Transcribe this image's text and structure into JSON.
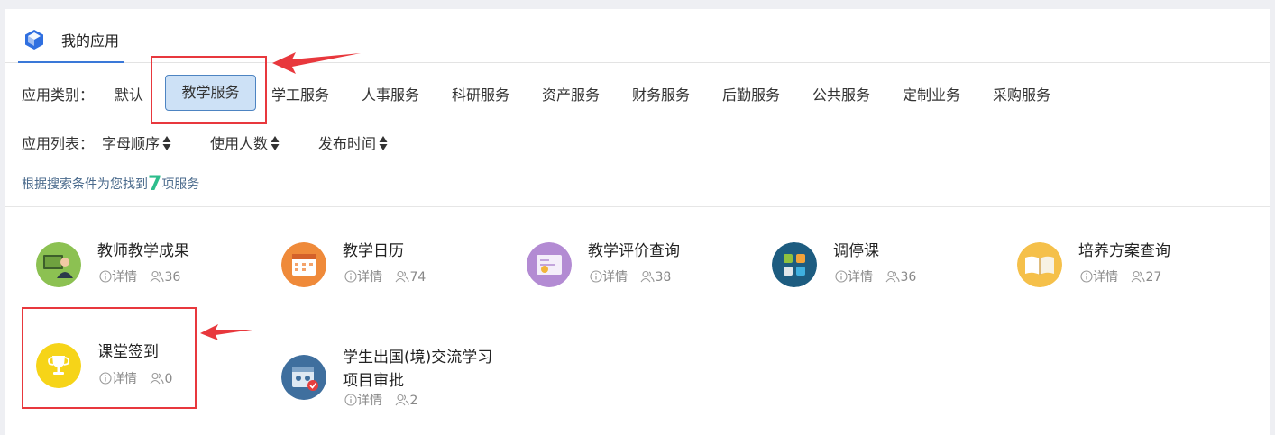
{
  "tabs": {
    "mine": "我的应用"
  },
  "category": {
    "label": "应用类别：",
    "items": [
      "默认",
      "教学服务",
      "学工服务",
      "人事服务",
      "科研服务",
      "资产服务",
      "财务服务",
      "后勤服务",
      "公共服务",
      "定制业务",
      "采购服务"
    ],
    "selected": "教学服务"
  },
  "list": {
    "label": "应用列表：",
    "sorts": [
      "字母顺序",
      "使用人数",
      "发布时间"
    ]
  },
  "result": {
    "prefix": "根据搜索条件为您找到",
    "count": "7",
    "suffix": "项服务"
  },
  "apps": [
    {
      "name": "教师教学成果",
      "detail": "详情",
      "users": "36",
      "icon": "teacher-icon",
      "color": "#8cc152"
    },
    {
      "name": "教学日历",
      "detail": "详情",
      "users": "74",
      "icon": "calendar-icon",
      "color": "#ef8a3a"
    },
    {
      "name": "教学评价查询",
      "detail": "详情",
      "users": "38",
      "icon": "evaluation-icon",
      "color": "#b38bd3"
    },
    {
      "name": "调停课",
      "detail": "详情",
      "users": "36",
      "icon": "apps-grid-icon",
      "color": "#1d5c80"
    },
    {
      "name": "培养方案查询",
      "detail": "详情",
      "users": "27",
      "icon": "book-icon",
      "color": "#f5c04a"
    },
    {
      "name": "课堂签到",
      "detail": "详情",
      "users": "0",
      "icon": "trophy-icon",
      "color": "#f6d418"
    },
    {
      "name": "学生出国(境)交流学习项目审批",
      "detail": "详情",
      "users": "2",
      "icon": "approval-icon",
      "color": "#3f6f9e"
    }
  ],
  "colors": {
    "accent": "#3a78d8",
    "highlight": "#e8383d",
    "count": "#2dbd8c"
  }
}
